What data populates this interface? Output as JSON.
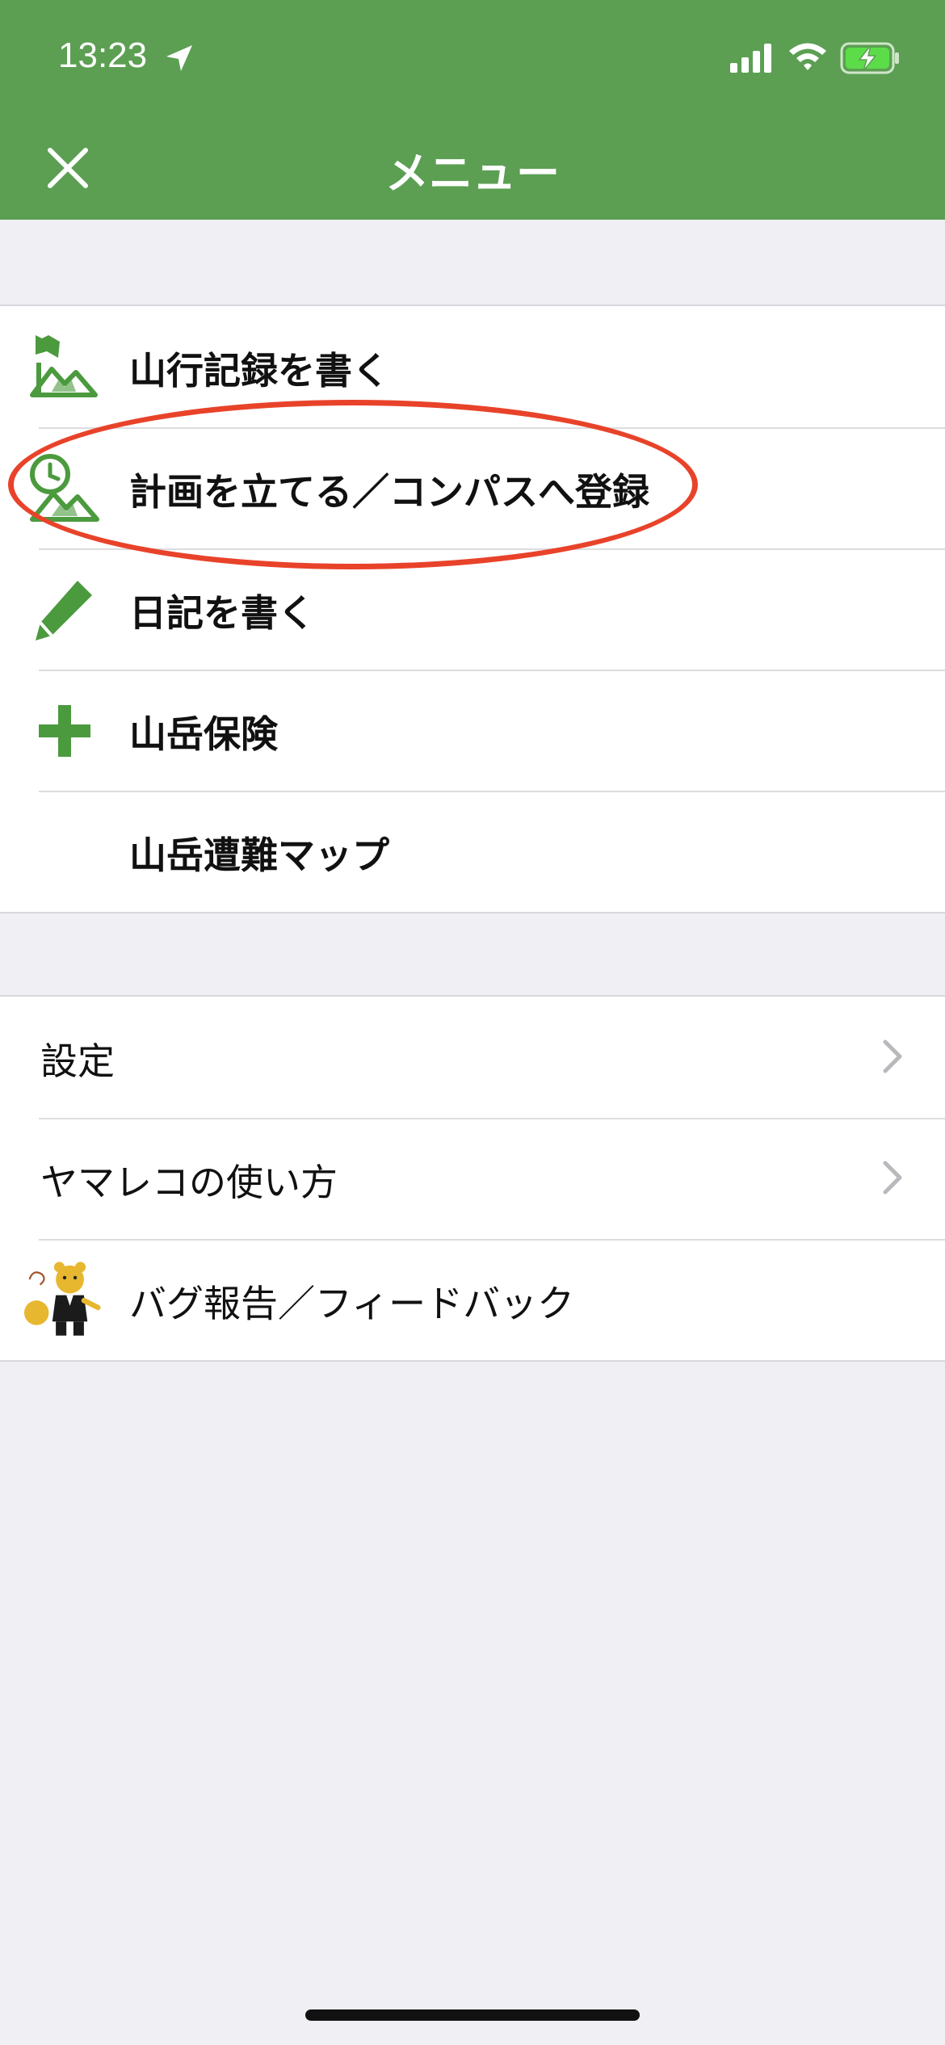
{
  "status_bar": {
    "time": "13:23"
  },
  "header": {
    "title": "メニュー",
    "close_icon": "close-icon"
  },
  "menu_primary": [
    {
      "label": "山行記録を書く",
      "icon": "flag-mountain-icon"
    },
    {
      "label": "計画を立てる／コンパスへ登録",
      "icon": "clock-mountain-icon"
    },
    {
      "label": "日記を書く",
      "icon": "pencil-icon"
    },
    {
      "label": "山岳保険",
      "icon": "plus-icon"
    },
    {
      "label": "山岳遭難マップ",
      "icon": ""
    }
  ],
  "menu_secondary": [
    {
      "label": "設定",
      "chevron": true
    },
    {
      "label": "ヤマレコの使い方",
      "chevron": true
    },
    {
      "label": "バグ報告／フィードバック",
      "icon": "mascot-icon"
    }
  ],
  "colors": {
    "header": "#5c9f53",
    "icon_green": "#4b9a3e",
    "highlight": "#e8432a",
    "background": "#efeff4"
  }
}
